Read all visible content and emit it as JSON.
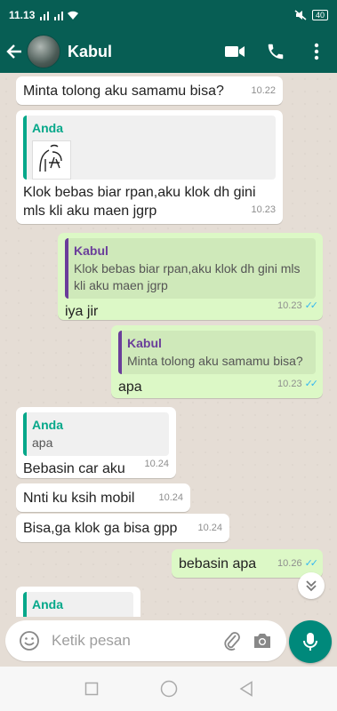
{
  "status": {
    "time": "11.13",
    "battery": "40"
  },
  "header": {
    "contact_name": "Kabul"
  },
  "messages": [
    {
      "text": "Minta tolong aku samamu bisa?",
      "time": "10.22"
    },
    {
      "quote_name": "Anda",
      "text": "Klok bebas biar rpan,aku klok dh gini mls kli aku maen jgrp",
      "time": "10.23"
    },
    {
      "quote_name": "Kabul",
      "quote_text": "Klok bebas biar rpan,aku klok dh gini mls kli aku maen jgrp",
      "text": "iya jir",
      "time": "10.23"
    },
    {
      "quote_name": "Kabul",
      "quote_text": "Minta tolong aku samamu bisa?",
      "text": "apa",
      "time": "10.23"
    },
    {
      "quote_name": "Anda",
      "quote_text": "apa",
      "text": "Bebasin car aku",
      "time": "10.24"
    },
    {
      "text": "Nnti ku ksih mobil",
      "time": "10.24"
    },
    {
      "text": "Bisa,ga klok ga bisa gpp",
      "time": "10.24"
    },
    {
      "text": "bebasin apa",
      "time": "10.26"
    },
    {
      "quote_name": "Anda"
    }
  ],
  "composer": {
    "placeholder": "Ketik pesan"
  },
  "icons": {
    "back": "arrow-left-icon",
    "video": "video-call-icon",
    "call": "phone-icon",
    "menu": "more-vert-icon",
    "emoji": "emoji-icon",
    "attach": "paperclip-icon",
    "camera": "camera-icon",
    "mic": "mic-icon",
    "scroll": "double-chevron-down-icon",
    "nav_back": "triangle-back-icon",
    "nav_home": "circle-home-icon",
    "nav_recent": "square-recent-icon"
  },
  "colors": {
    "header": "#075e54",
    "outgoing": "#dcf8c6",
    "incoming": "#ffffff",
    "accent": "#00897b",
    "read_ticks": "#34b7f1"
  }
}
